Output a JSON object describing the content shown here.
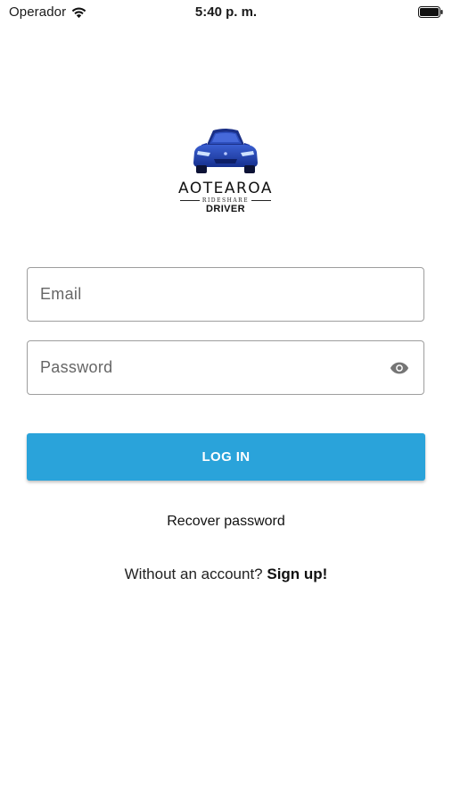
{
  "status_bar": {
    "carrier": "Operador",
    "time": "5:40 p. m."
  },
  "logo": {
    "brand": "AOTEAROA",
    "subtitle": "RIDESHARE",
    "tag": "DRIVER"
  },
  "form": {
    "email_placeholder": "Email",
    "password_placeholder": "Password",
    "login_label": "LOG IN",
    "recover_label": "Recover password",
    "signup_prompt": "Without an account?",
    "signup_label": "Sign up!"
  },
  "colors": {
    "primary": "#2aa3da",
    "car": "#1e3fa8"
  },
  "icons": [
    "wifi-icon",
    "battery-icon",
    "car-logo-icon",
    "eye-icon"
  ]
}
